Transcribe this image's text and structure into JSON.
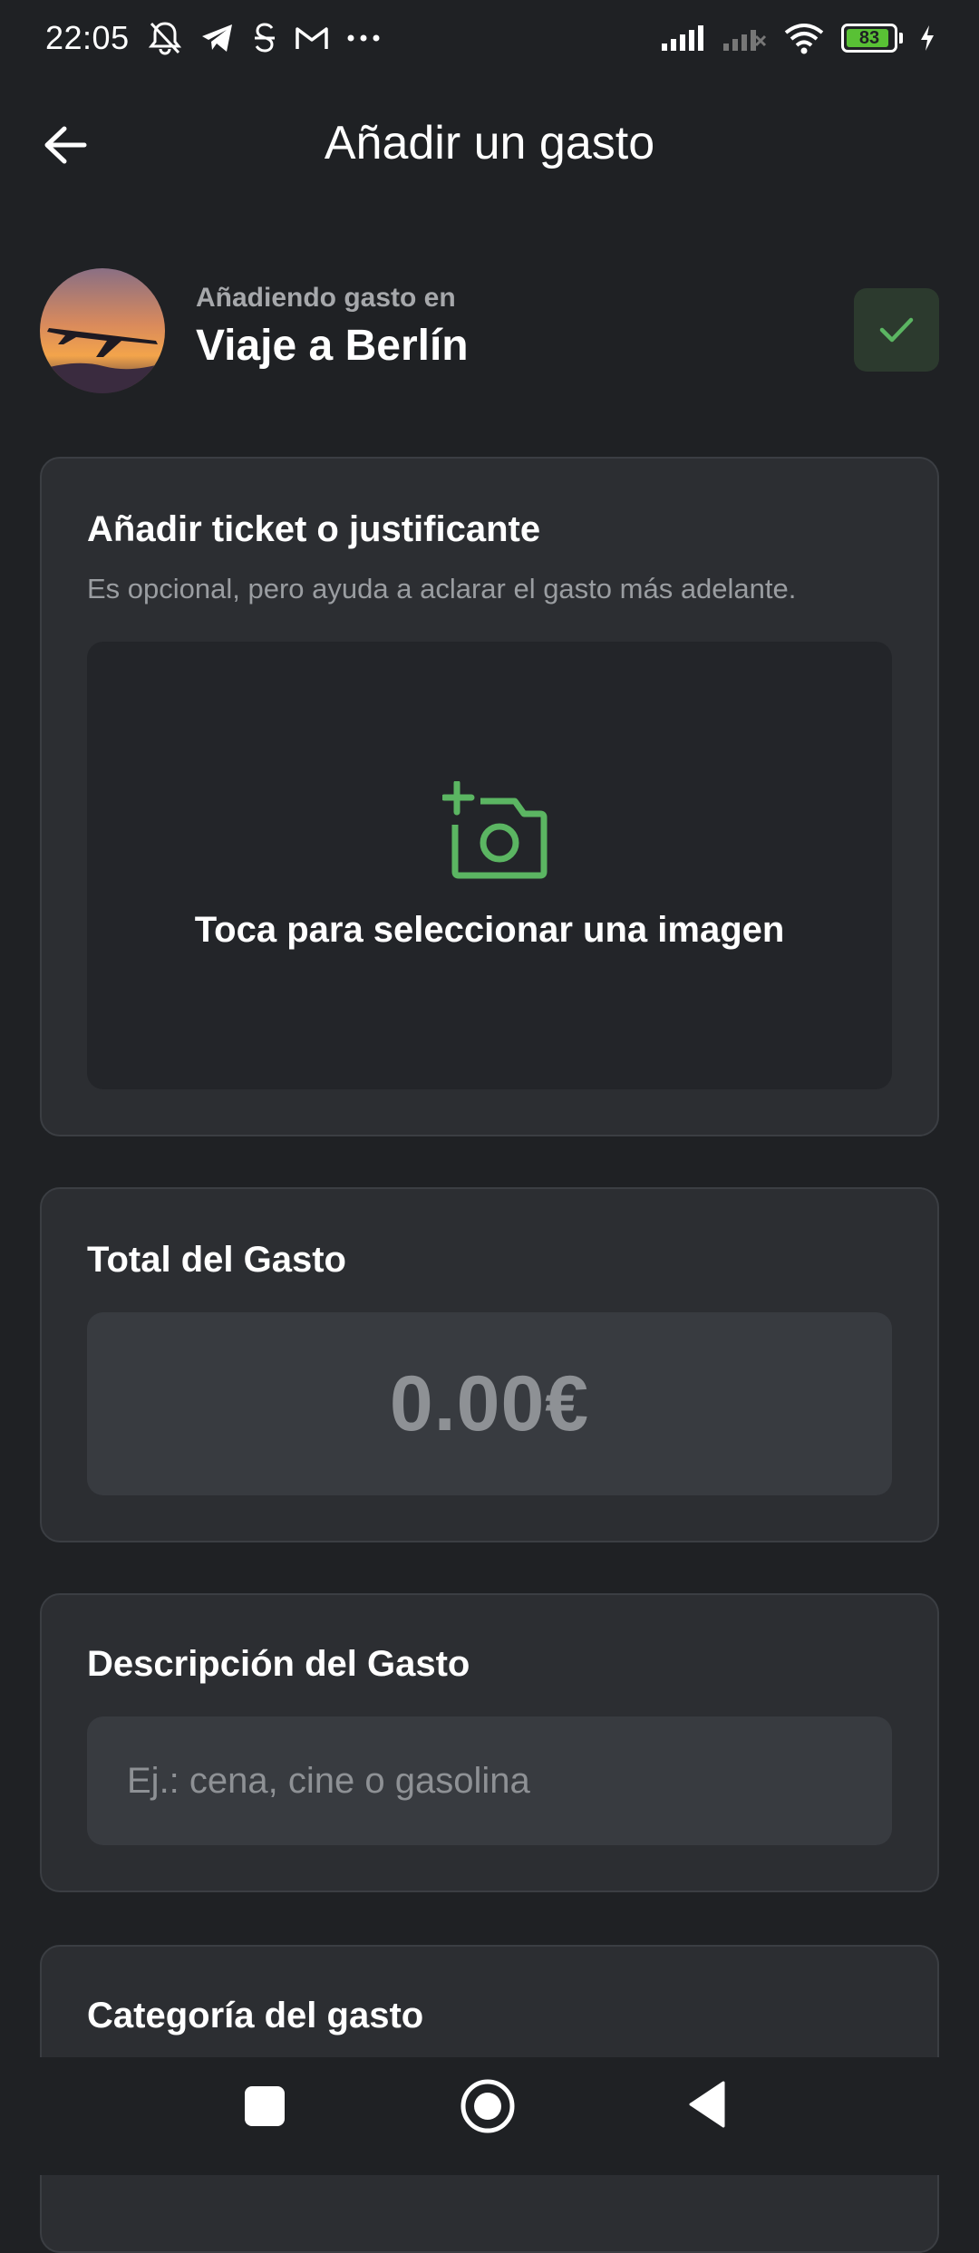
{
  "status_bar": {
    "time": "22:05",
    "battery_level": "83",
    "icons_left": [
      "mute-notifications-icon",
      "telegram-icon",
      "app-s-icon",
      "gmail-icon",
      "more-dots-icon"
    ],
    "icons_right": [
      "signal-icon",
      "signal-no-service-icon",
      "wifi-icon",
      "battery-icon",
      "charging-icon"
    ],
    "battery_color": "#59c135"
  },
  "app_bar": {
    "title": "Añadir un gasto",
    "back_icon": "arrow-back-icon"
  },
  "group": {
    "subtitle": "Añadiendo gasto en",
    "name": "Viaje a Berlín",
    "avatar": "airplane-sunset-image",
    "confirm_icon": "check-icon"
  },
  "receipt": {
    "title": "Añadir ticket o justificante",
    "subtitle": "Es opcional, pero ayuda a aclarar el gasto más adelante.",
    "picker_label": "Toca para seleccionar una imagen",
    "picker_icon": "add-photo-camera-icon"
  },
  "total": {
    "title": "Total del Gasto",
    "value": "0.00€"
  },
  "description": {
    "title": "Descripción del Gasto",
    "placeholder": "Ej.: cena, cine o gasolina",
    "value": ""
  },
  "category": {
    "title": "Categoría del gasto"
  },
  "colors": {
    "accent": "#5bb562",
    "background": "#1f2124",
    "card": "#2c2e32",
    "field": "#383b40"
  },
  "nav_bar": {
    "recents_icon": "square-recents-icon",
    "home_icon": "circle-home-icon",
    "back_icon": "triangle-back-icon"
  }
}
